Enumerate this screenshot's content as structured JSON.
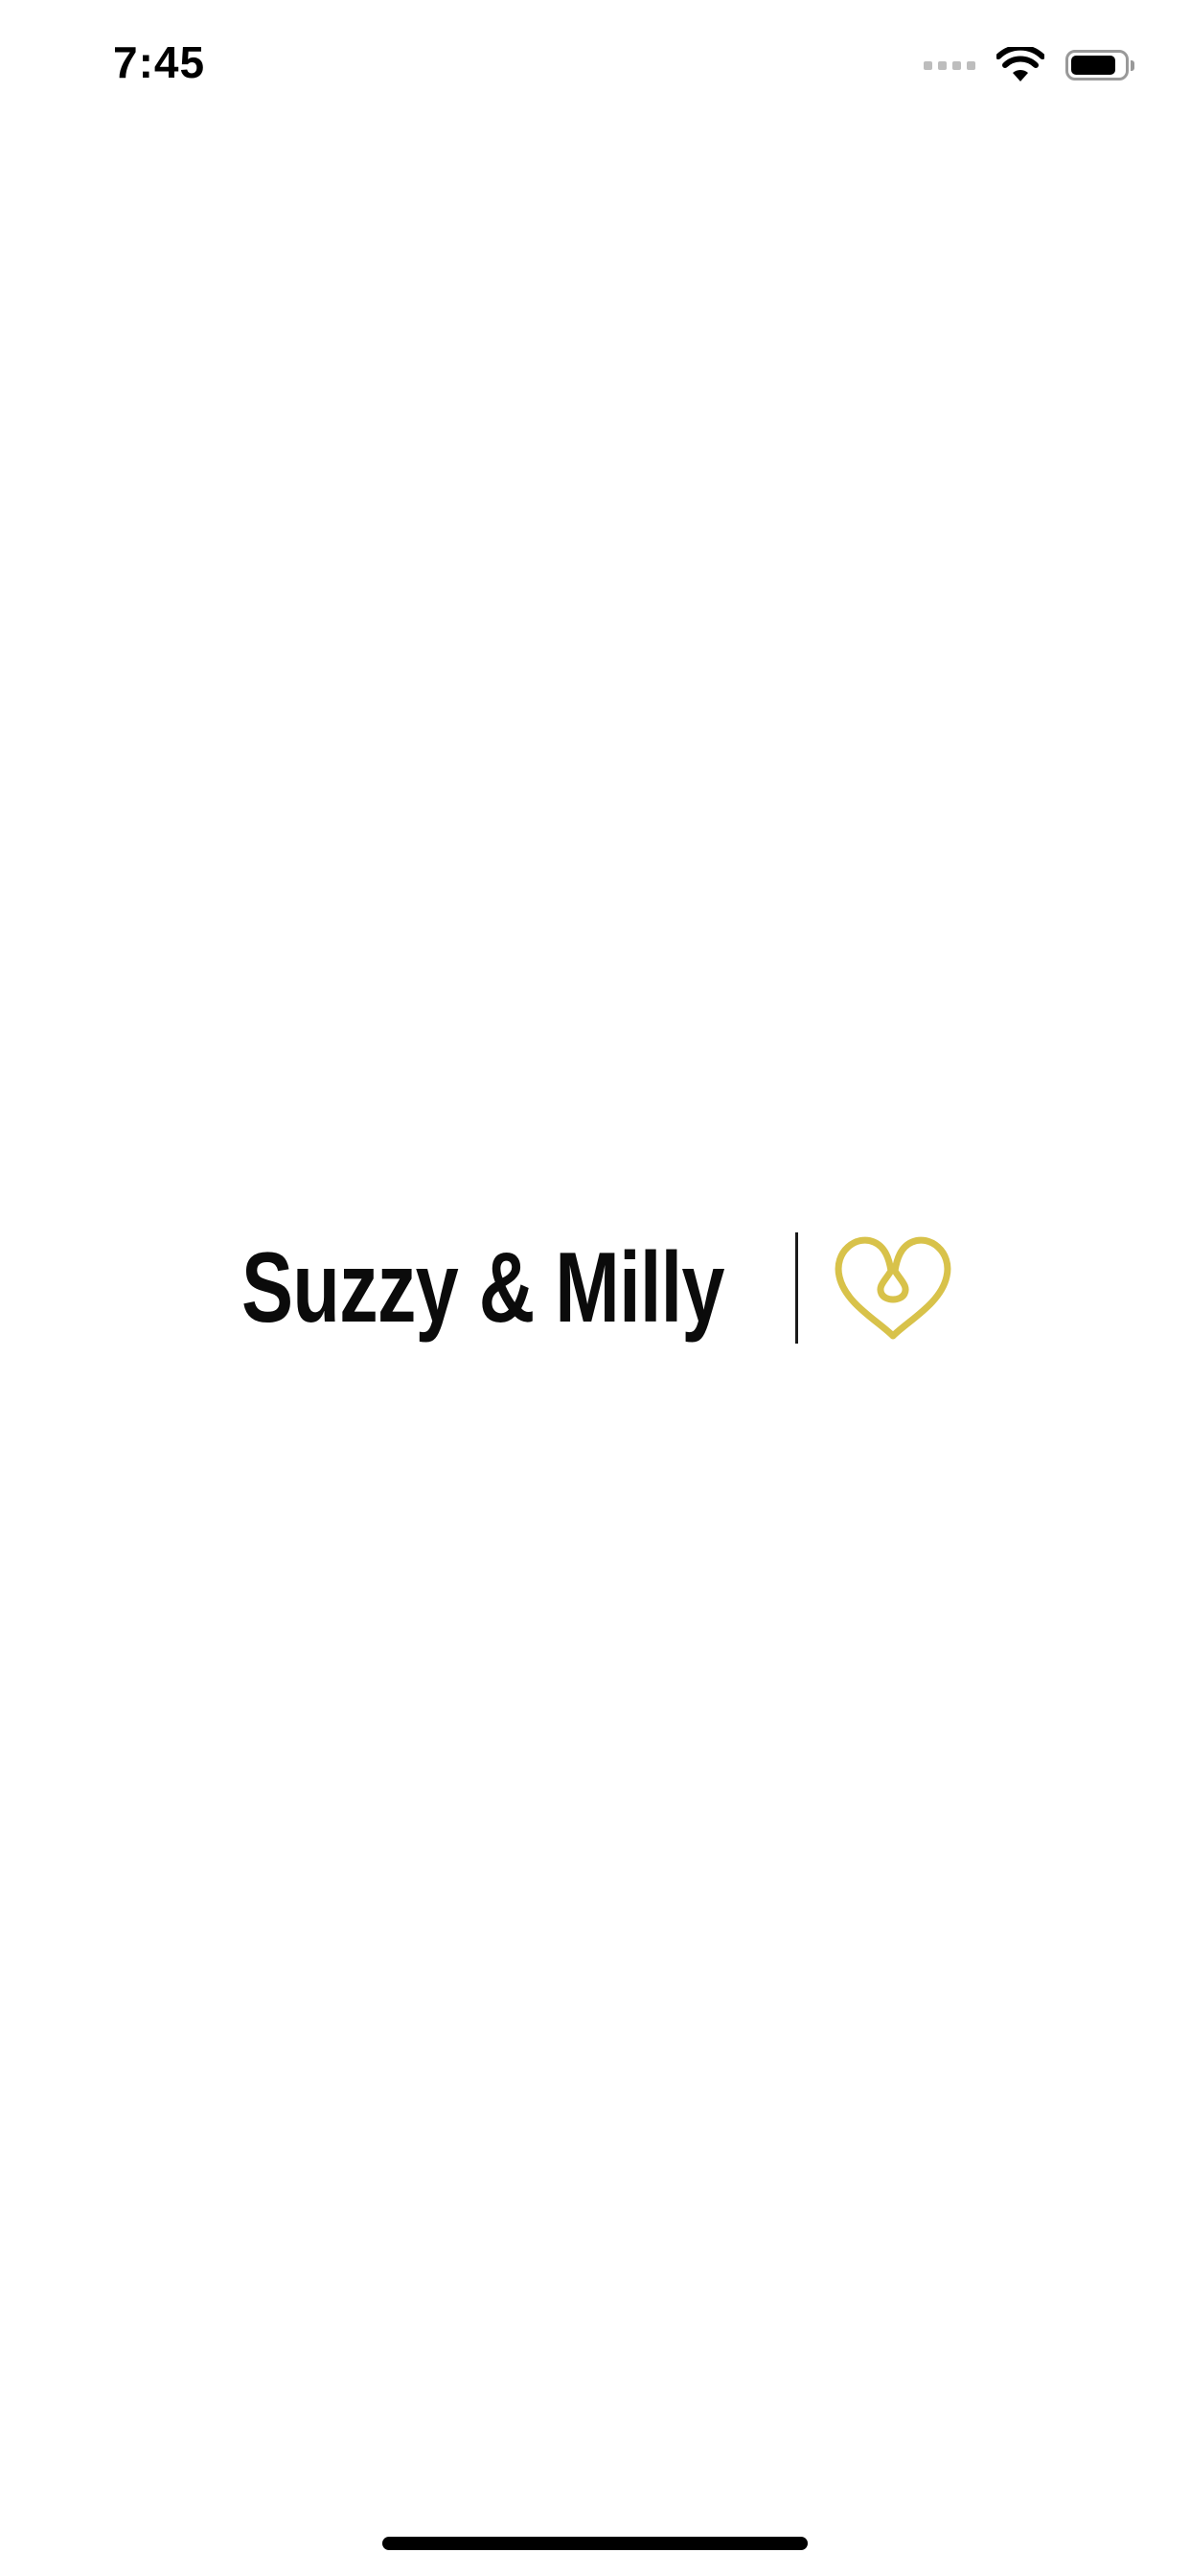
{
  "status_bar": {
    "time": "7:45",
    "battery_level": 0.85,
    "icons": [
      "cellular-signal-icon",
      "wifi-icon",
      "battery-icon"
    ]
  },
  "splash": {
    "brand_name": "Suzzy & Milly",
    "logo_icon": "heart-loop-icon",
    "accent_color": "#d8c24a",
    "text_color": "#0b0b0b"
  },
  "home_indicator": {
    "color": "#000000"
  }
}
